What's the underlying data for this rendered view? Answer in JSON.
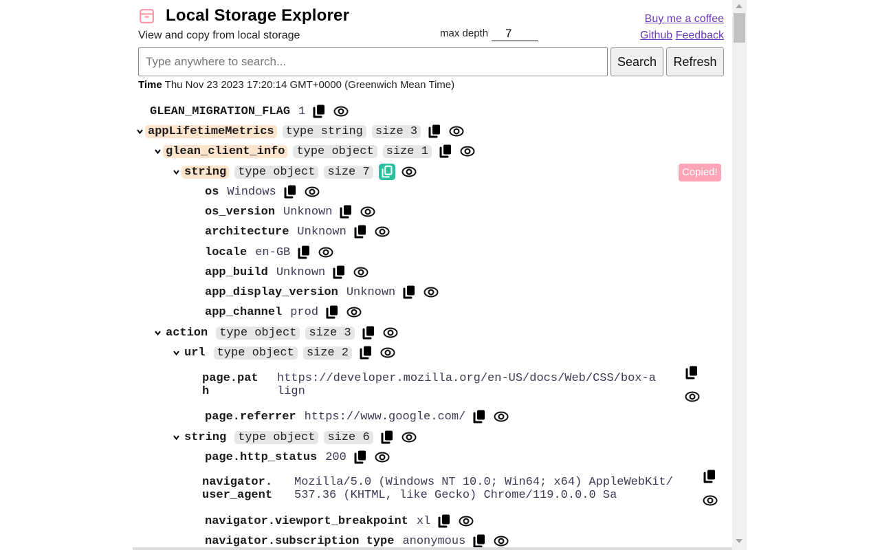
{
  "header": {
    "icon": "archive-box-icon",
    "title": "Local Storage Explorer",
    "subtitle": "View and copy from local storage",
    "max_depth_label": "max depth",
    "max_depth_value": "7",
    "links": {
      "coffee": "Buy me a coffee",
      "github": "Github",
      "feedback": "Feedback"
    }
  },
  "search": {
    "placeholder": "Type anywhere to search...",
    "value": "",
    "search_button": "Search",
    "refresh_button": "Refresh"
  },
  "time": {
    "label": "Time",
    "value": "Thu Nov 23 2023 17:20:14 GMT+0000 (Greenwich Mean Time)"
  },
  "copied_badge": "Copied!",
  "accent_colors": {
    "highlight": "#fbe3cc",
    "tag_bg": "#e6e6e6",
    "copied_icon": "#2bbf9f",
    "copied_badge": "#ffa5b7",
    "link": "#6a3bb8"
  },
  "tree": [
    {
      "key": "GLEAN_MIGRATION_FLAG",
      "value": "1"
    },
    {
      "key": "appLifetimeMetrics",
      "type": "type string",
      "size": "size 3",
      "expanded": true
    },
    {
      "key": "glean_client_info",
      "type": "type object",
      "size": "size 1",
      "expanded": true
    },
    {
      "key": "string",
      "type": "type object",
      "size": "size 7",
      "expanded": true,
      "copied": true
    },
    {
      "key": "os",
      "value": "Windows"
    },
    {
      "key": "os_version",
      "value": "Unknown"
    },
    {
      "key": "architecture",
      "value": "Unknown"
    },
    {
      "key": "locale",
      "value": "en-GB"
    },
    {
      "key": "app_build",
      "value": "Unknown"
    },
    {
      "key": "app_display_version",
      "value": "Unknown"
    },
    {
      "key": "app_channel",
      "value": "prod"
    },
    {
      "key": "action",
      "type": "type object",
      "size": "size 3",
      "expanded": true
    },
    {
      "key": "url",
      "type": "type object",
      "size": "size 2",
      "expanded": true
    },
    {
      "key_lines": [
        "page.pat",
        "h"
      ],
      "value_lines": [
        "https://developer.mozilla.org/en-US/docs/Web/CSS/box-a",
        "lign"
      ]
    },
    {
      "key": "page.referrer",
      "value": "https://www.google.com/"
    },
    {
      "key": "string",
      "type": "type object",
      "size": "size 6",
      "expanded": true
    },
    {
      "key": "page.http_status",
      "value": "200"
    },
    {
      "key_lines": [
        "navigator.",
        "user_agent"
      ],
      "value_lines": [
        "Mozilla/5.0 (Windows NT 10.0; Win64; x64) AppleWebKit/",
        "537.36 (KHTML, like Gecko) Chrome/119.0.0.0 Sa"
      ]
    },
    {
      "key": "navigator.viewport_breakpoint",
      "value": "xl"
    },
    {
      "key": "navigator.subscription type",
      "value": "anonymous"
    }
  ]
}
